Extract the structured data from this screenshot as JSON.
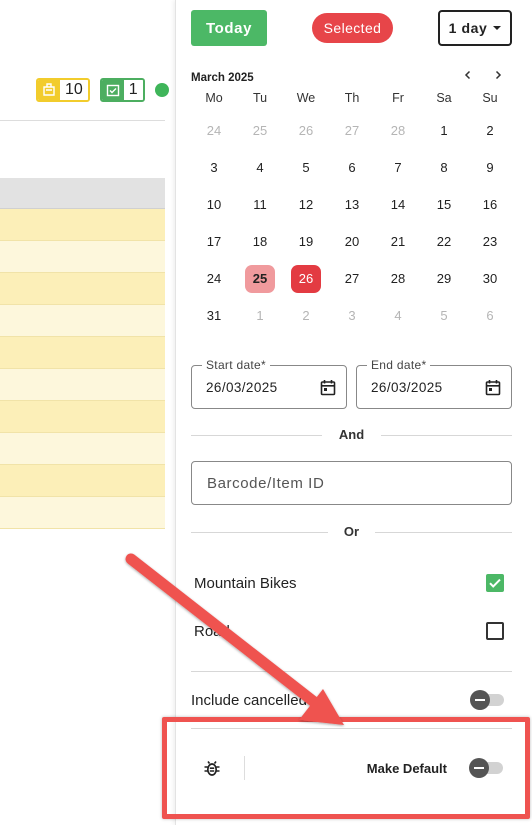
{
  "badges": [
    {
      "icon": "box-icon",
      "count": "10",
      "color": "#f2cc2c"
    },
    {
      "icon": "calendar-check-icon",
      "count": "1",
      "color": "#4cae60"
    }
  ],
  "top_bar": {
    "today_label": "Today",
    "selected_label": "Selected",
    "range_label": "1 day"
  },
  "calendar": {
    "month_title": "March 2025",
    "days_of_week": [
      "Mo",
      "Tu",
      "We",
      "Th",
      "Fr",
      "Sa",
      "Su"
    ],
    "weeks": [
      [
        {
          "d": "24",
          "o": true
        },
        {
          "d": "25",
          "o": true
        },
        {
          "d": "26",
          "o": true
        },
        {
          "d": "27",
          "o": true
        },
        {
          "d": "28",
          "o": true
        },
        {
          "d": "1"
        },
        {
          "d": "2"
        }
      ],
      [
        {
          "d": "3"
        },
        {
          "d": "4"
        },
        {
          "d": "5"
        },
        {
          "d": "6"
        },
        {
          "d": "7"
        },
        {
          "d": "8"
        },
        {
          "d": "9"
        }
      ],
      [
        {
          "d": "10"
        },
        {
          "d": "11"
        },
        {
          "d": "12"
        },
        {
          "d": "13"
        },
        {
          "d": "14"
        },
        {
          "d": "15"
        },
        {
          "d": "16"
        }
      ],
      [
        {
          "d": "17"
        },
        {
          "d": "18"
        },
        {
          "d": "19"
        },
        {
          "d": "20"
        },
        {
          "d": "21"
        },
        {
          "d": "22"
        },
        {
          "d": "23"
        }
      ],
      [
        {
          "d": "24"
        },
        {
          "d": "25",
          "s": "start"
        },
        {
          "d": "26",
          "s": "end"
        },
        {
          "d": "27"
        },
        {
          "d": "28"
        },
        {
          "d": "29"
        },
        {
          "d": "30"
        }
      ],
      [
        {
          "d": "31"
        },
        {
          "d": "1",
          "o": true
        },
        {
          "d": "2",
          "o": true
        },
        {
          "d": "3",
          "o": true
        },
        {
          "d": "4",
          "o": true
        },
        {
          "d": "5",
          "o": true
        },
        {
          "d": "6",
          "o": true
        }
      ]
    ],
    "range_start_color": "#f09a9d",
    "range_end_color": "#e33b42"
  },
  "start_date": {
    "label": "Start date*",
    "value": "26/03/2025"
  },
  "end_date": {
    "label": "End date*",
    "value": "26/03/2025"
  },
  "and_label": "And",
  "barcode": {
    "placeholder": "Barcode/Item ID",
    "value": ""
  },
  "or_label": "Or",
  "categories": [
    {
      "label": "Mountain Bikes",
      "checked": true
    },
    {
      "label": "Road",
      "checked": false
    }
  ],
  "include_cancelled": {
    "label": "Include cancelled",
    "on": false
  },
  "footer": {
    "bug_icon": "bug-icon",
    "make_default_label": "Make Default",
    "make_default_on": false
  },
  "annotation_color": "#ef5350"
}
